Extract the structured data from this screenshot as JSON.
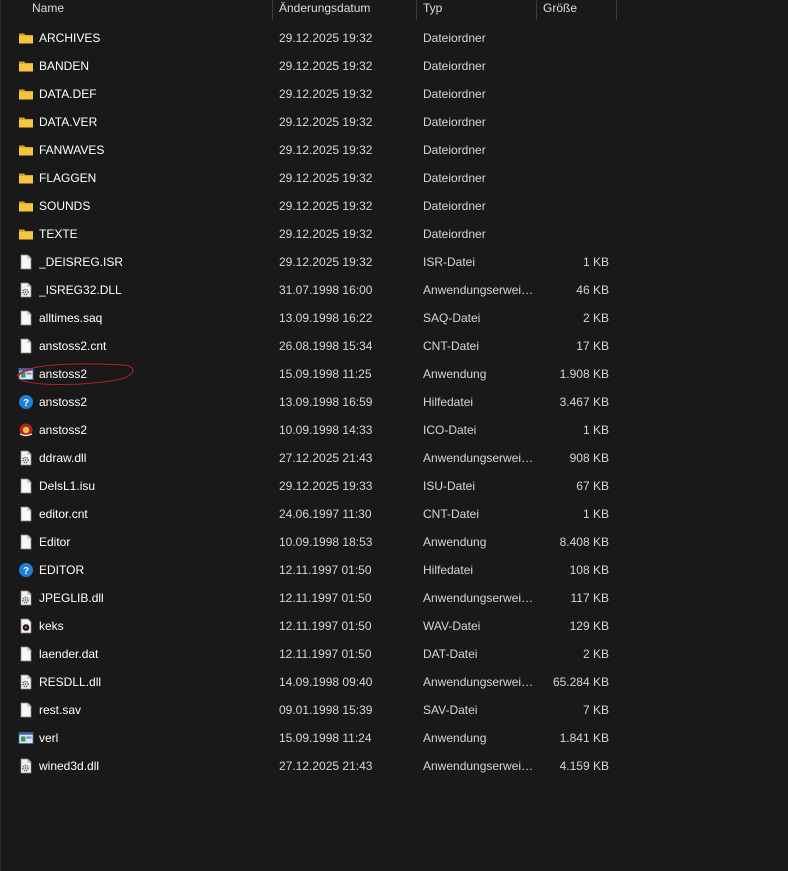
{
  "columns": {
    "name": "Name",
    "date": "Änderungsdatum",
    "type": "Typ",
    "size": "Größe"
  },
  "files": [
    {
      "name": "ARCHIVES",
      "date": "29.12.2025 19:32",
      "type": "Dateiordner",
      "size": "",
      "icon": "folder-icon"
    },
    {
      "name": "BANDEN",
      "date": "29.12.2025 19:32",
      "type": "Dateiordner",
      "size": "",
      "icon": "folder-icon"
    },
    {
      "name": "DATA.DEF",
      "date": "29.12.2025 19:32",
      "type": "Dateiordner",
      "size": "",
      "icon": "folder-icon"
    },
    {
      "name": "DATA.VER",
      "date": "29.12.2025 19:32",
      "type": "Dateiordner",
      "size": "",
      "icon": "folder-icon"
    },
    {
      "name": "FANWAVES",
      "date": "29.12.2025 19:32",
      "type": "Dateiordner",
      "size": "",
      "icon": "folder-icon"
    },
    {
      "name": "FLAGGEN",
      "date": "29.12.2025 19:32",
      "type": "Dateiordner",
      "size": "",
      "icon": "folder-icon"
    },
    {
      "name": "SOUNDS",
      "date": "29.12.2025 19:32",
      "type": "Dateiordner",
      "size": "",
      "icon": "folder-icon"
    },
    {
      "name": "TEXTE",
      "date": "29.12.2025 19:32",
      "type": "Dateiordner",
      "size": "",
      "icon": "folder-icon"
    },
    {
      "name": "_DEISREG.ISR",
      "date": "29.12.2025 19:32",
      "type": "ISR-Datei",
      "size": "1 KB",
      "icon": "file-icon"
    },
    {
      "name": "_ISREG32.DLL",
      "date": "31.07.1998 16:00",
      "type": "Anwendungserweiterung",
      "size": "46 KB",
      "icon": "dll-icon"
    },
    {
      "name": "alltimes.saq",
      "date": "13.09.1998 16:22",
      "type": "SAQ-Datei",
      "size": "2 KB",
      "icon": "file-icon"
    },
    {
      "name": "anstoss2.cnt",
      "date": "26.08.1998 15:34",
      "type": "CNT-Datei",
      "size": "17 KB",
      "icon": "file-icon"
    },
    {
      "name": "anstoss2",
      "date": "15.09.1998 11:25",
      "type": "Anwendung",
      "size": "1.908 KB",
      "icon": "app-icon"
    },
    {
      "name": "anstoss2",
      "date": "13.09.1998 16:59",
      "type": "Hilfedatei",
      "size": "3.467 KB",
      "icon": "help-icon"
    },
    {
      "name": "anstoss2",
      "date": "10.09.1998 14:33",
      "type": "ICO-Datei",
      "size": "1 KB",
      "icon": "ico-icon"
    },
    {
      "name": "ddraw.dll",
      "date": "27.12.2025 21:43",
      "type": "Anwendungserweiterung",
      "size": "908 KB",
      "icon": "dll-icon"
    },
    {
      "name": "DelsL1.isu",
      "date": "29.12.2025 19:33",
      "type": "ISU-Datei",
      "size": "67 KB",
      "icon": "file-icon"
    },
    {
      "name": "editor.cnt",
      "date": "24.06.1997 11:30",
      "type": "CNT-Datei",
      "size": "1 KB",
      "icon": "file-icon"
    },
    {
      "name": "Editor",
      "date": "10.09.1998 18:53",
      "type": "Anwendung",
      "size": "8.408 KB",
      "icon": "file-icon"
    },
    {
      "name": "EDITOR",
      "date": "12.11.1997 01:50",
      "type": "Hilfedatei",
      "size": "108 KB",
      "icon": "help-icon"
    },
    {
      "name": "JPEGLIB.dll",
      "date": "12.11.1997 01:50",
      "type": "Anwendungserweiterung",
      "size": "117 KB",
      "icon": "dll-icon"
    },
    {
      "name": "keks",
      "date": "12.11.1997 01:50",
      "type": "WAV-Datei",
      "size": "129 KB",
      "icon": "audio-icon"
    },
    {
      "name": "laender.dat",
      "date": "12.11.1997 01:50",
      "type": "DAT-Datei",
      "size": "2 KB",
      "icon": "file-icon"
    },
    {
      "name": "RESDLL.dll",
      "date": "14.09.1998 09:40",
      "type": "Anwendungserweiterung",
      "size": "65.284 KB",
      "icon": "dll-icon"
    },
    {
      "name": "rest.sav",
      "date": "09.01.1998 15:39",
      "type": "SAV-Datei",
      "size": "7 KB",
      "icon": "file-icon"
    },
    {
      "name": "verl",
      "date": "15.09.1998 11:24",
      "type": "Anwendung",
      "size": "1.841 KB",
      "icon": "app-icon"
    },
    {
      "name": "wined3d.dll",
      "date": "27.12.2025 21:43",
      "type": "Anwendungserweiterung",
      "size": "4.159 KB",
      "icon": "dll-icon"
    }
  ],
  "colors": {
    "background": "#191919",
    "folder": "#f5c542",
    "annotation": "#b3202a"
  }
}
